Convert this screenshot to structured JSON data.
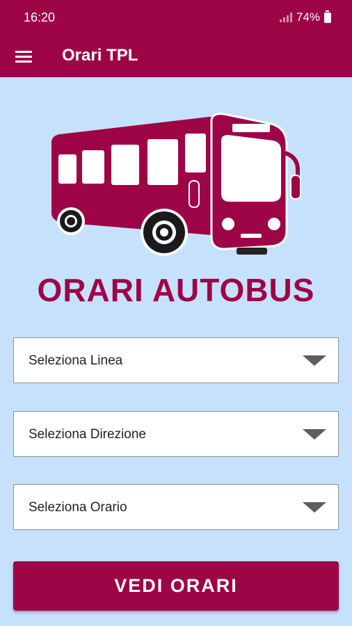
{
  "status_bar": {
    "time": "16:20",
    "battery": "74%"
  },
  "app_bar": {
    "title": "Orari TPL"
  },
  "brand": {
    "title": "ORARI AUTOBUS"
  },
  "selects": {
    "line": {
      "placeholder": "Seleziona Linea"
    },
    "direction": {
      "placeholder": "Seleziona Direzione"
    },
    "time": {
      "placeholder": "Seleziona Orario"
    }
  },
  "actions": {
    "view_label": "VEDI ORARI"
  },
  "colors": {
    "primary": "#9e0546",
    "background": "#c6e1fb"
  },
  "icons": {
    "menu": "hamburger-menu-icon",
    "dropdown": "triangle-down-icon"
  }
}
